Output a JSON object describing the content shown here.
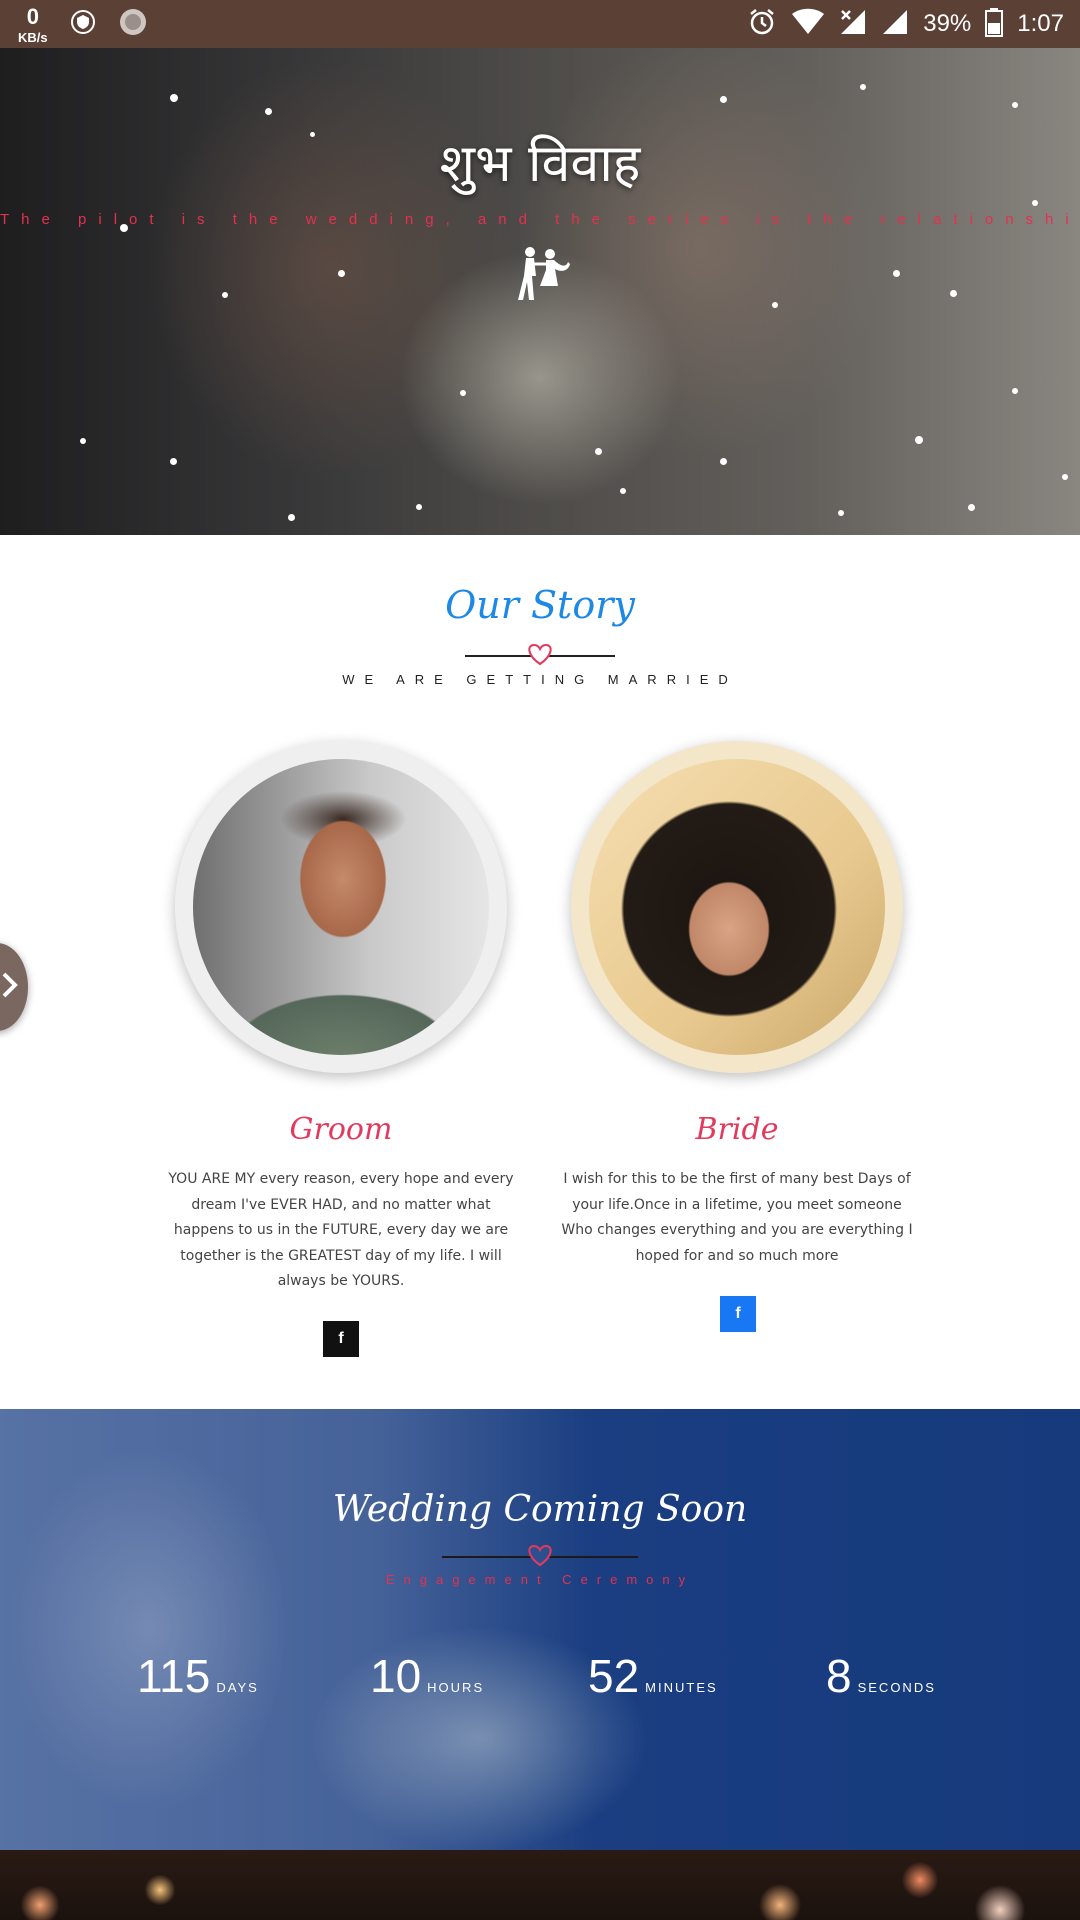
{
  "status_bar": {
    "speed_value": "0",
    "speed_unit": "KB/s",
    "battery": "39%",
    "time": "1:07"
  },
  "hero": {
    "title": "शुभ विवाह",
    "tagline": "The pilot is the wedding, and the series is the relationship."
  },
  "story": {
    "title": "Our Story",
    "subtitle": "WE ARE GETTING MARRIED",
    "groom": {
      "name": "Groom",
      "text": "YOU ARE MY every reason, every hope and every dream I've EVER HAD, and no matter what happens to us in the FUTURE, every day we are together is the GREATEST day of my life. I will always be YOURS.",
      "social": "f"
    },
    "bride": {
      "name": "Bride",
      "text": "I wish for this to be the first of many best Days of your life.Once in a lifetime, you meet someone Who changes everything and you are everything I hoped for and so much more",
      "social": "f"
    }
  },
  "countdown": {
    "title": "Wedding Coming Soon",
    "subtitle": "Engagement Ceremony",
    "days": "115",
    "days_label": "DAYS",
    "hours": "10",
    "hours_label": "HOURS",
    "minutes": "52",
    "minutes_label": "MINUTES",
    "seconds": "8",
    "seconds_label": "SECONDS"
  },
  "colors": {
    "accent_blue": "#1e88e5",
    "accent_pink": "#e23a5d",
    "facebook_blue": "#1877f2",
    "status_bar": "#5b4036"
  }
}
